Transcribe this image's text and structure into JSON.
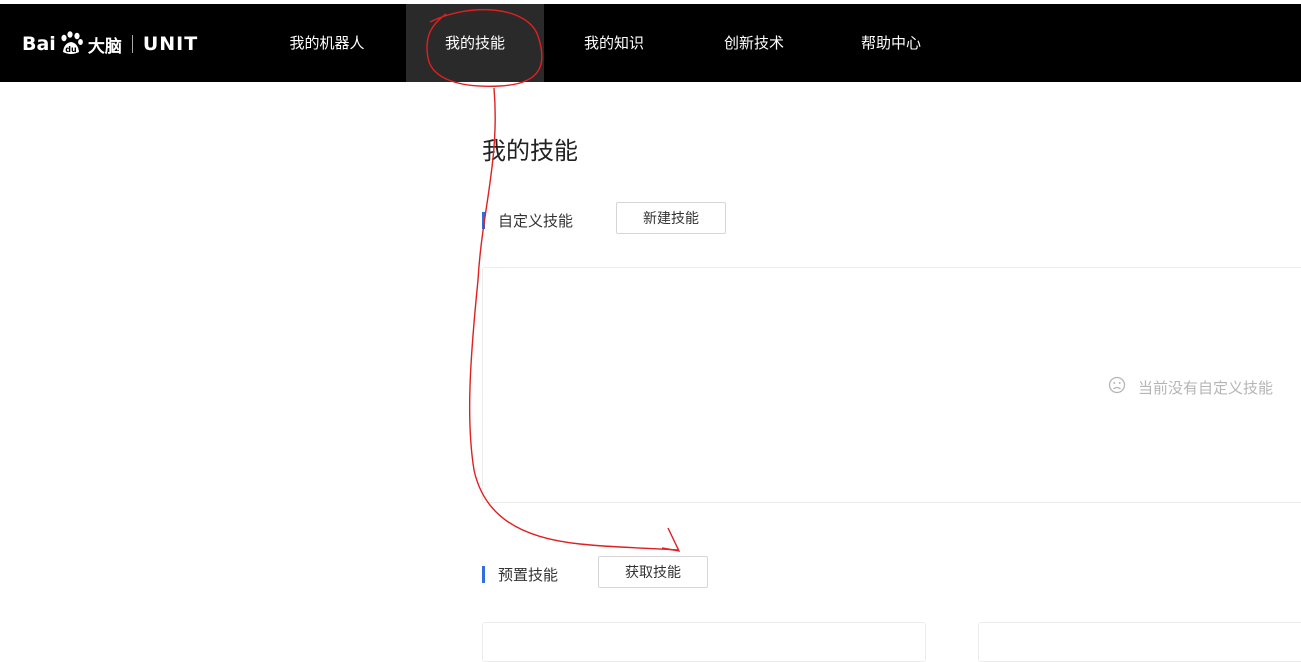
{
  "navbar": {
    "logo": {
      "bai": "Bai",
      "paw_text": "du",
      "dana": "大脑",
      "unit": "UNIT"
    },
    "items": [
      {
        "label": "我的机器人",
        "active": false
      },
      {
        "label": "我的技能",
        "active": true
      },
      {
        "label": "我的知识",
        "active": false
      },
      {
        "label": "创新技术",
        "active": false
      },
      {
        "label": "帮助中心",
        "active": false
      }
    ]
  },
  "main": {
    "title": "我的技能",
    "custom_section": {
      "label": "自定义技能",
      "button": "新建技能",
      "empty_text": "当前没有自定义技能"
    },
    "preset_section": {
      "label": "预置技能",
      "button": "获取技能"
    }
  },
  "colors": {
    "navbar_bg": "#000000",
    "nav_active_bg": "#2a2a2a",
    "accent_bar": "#2f6fde",
    "annotation": "#e02020"
  },
  "icons": {
    "empty_state": "sad-face-icon",
    "logo_mark": "baidu-paw-icon"
  }
}
